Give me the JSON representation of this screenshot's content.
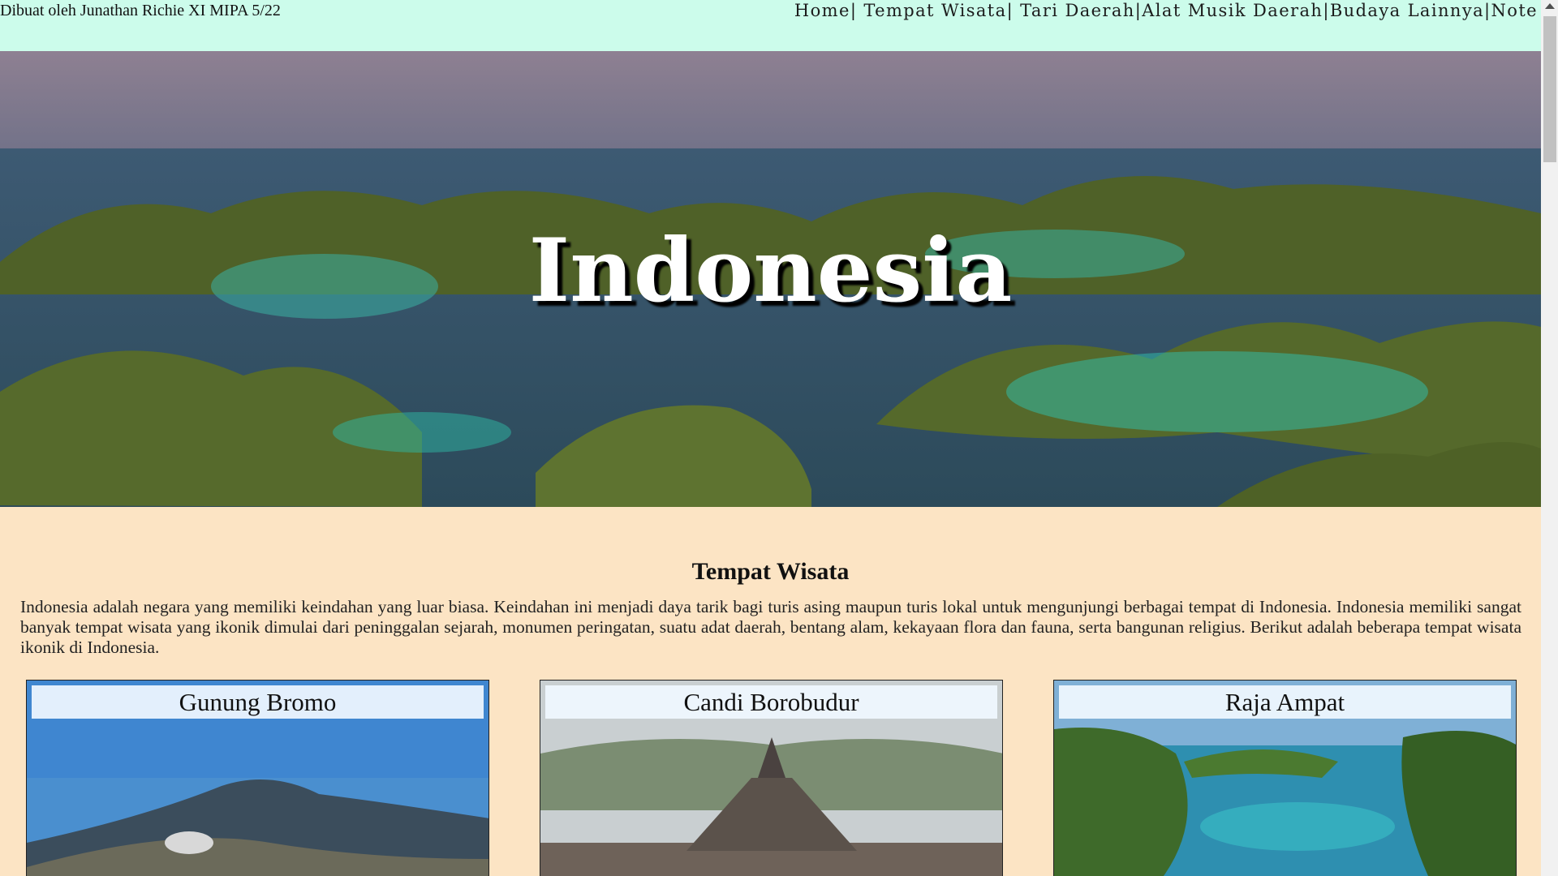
{
  "header": {
    "credit": "Dibuat oleh Junathan Richie XI MIPA 5/22",
    "nav": [
      {
        "label": "Home",
        "sep": "| "
      },
      {
        "label": "Tempat Wisata",
        "sep": "| "
      },
      {
        "label": "Tari Daerah",
        "sep": "|"
      },
      {
        "label": "Alat Musik Daerah",
        "sep": "|"
      },
      {
        "label": "Budaya Lainnya",
        "sep": "|"
      },
      {
        "label": "Note",
        "sep": ""
      }
    ]
  },
  "hero": {
    "title": "Indonesia"
  },
  "section": {
    "title": "Tempat Wisata",
    "intro": "Indonesia adalah negara yang memiliki keindahan yang luar biasa. Keindahan ini menjadi daya tarik bagi turis asing maupun turis lokal untuk mengunjungi berbagai tempat di Indonesia. Indonesia memiliki sangat banyak tempat wisata yang ikonik dimulai dari peninggalan sejarah, monumen peringatan, suatu adat daerah, bentang alam, kekayaan flora dan fauna, serta bangunan religius. Berikut adalah beberapa tempat wisata ikonik di Indonesia."
  },
  "cards": [
    {
      "title": "Gunung Bromo"
    },
    {
      "title": "Candi Borobudur"
    },
    {
      "title": "Raja Ampat"
    }
  ],
  "colors": {
    "topbar": "#ccfceb",
    "page_bg": "#fce4c4",
    "hero_water": "#2f6e78",
    "island_green": "#5d6d2a"
  }
}
